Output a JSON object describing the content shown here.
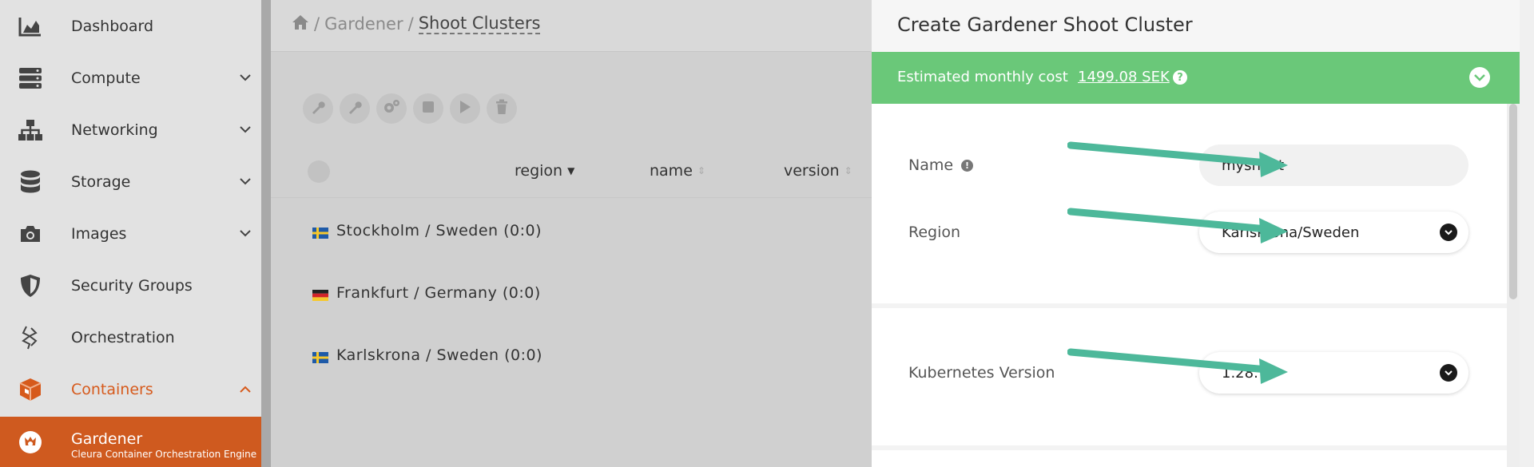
{
  "sidebar": {
    "items": [
      {
        "label": "Dashboard",
        "icon": "chart-area-icon"
      },
      {
        "label": "Compute",
        "icon": "server-icon"
      },
      {
        "label": "Networking",
        "icon": "sitemap-icon"
      },
      {
        "label": "Storage",
        "icon": "database-icon"
      },
      {
        "label": "Images",
        "icon": "camera-icon"
      },
      {
        "label": "Security Groups",
        "icon": "shield-icon"
      },
      {
        "label": "Orchestration",
        "icon": "orchestration-icon"
      },
      {
        "label": "Containers",
        "icon": "cube-icon"
      }
    ],
    "sub_item": {
      "label": "Gardener",
      "sublabel": "Cleura Container Orchestration Engine",
      "icon": "gardener-icon"
    },
    "accent_color": "#cf5a1f"
  },
  "breadcrumb": {
    "home_icon": "home-icon",
    "parent": "Gardener",
    "current": "Shoot Clusters"
  },
  "toolbar": {
    "icons": [
      "wrench-icon",
      "wrench-icon",
      "gears-icon",
      "stop-icon",
      "play-icon",
      "trash-icon"
    ]
  },
  "table": {
    "columns": [
      "region",
      "name",
      "version"
    ],
    "rows": [
      {
        "flag": "sweden",
        "label": "Stockholm / Sweden (0:0)"
      },
      {
        "flag": "germany",
        "label": "Frankfurt / Germany (0:0)"
      },
      {
        "flag": "sweden",
        "label": "Karlskrona / Sweden (0:0)"
      }
    ]
  },
  "panel": {
    "title": "Create Gardener Shoot Cluster",
    "cost_label": "Estimated monthly cost",
    "cost_value": "1499.08 SEK",
    "cost_color": "#6ac879",
    "fields": {
      "name": {
        "label": "Name",
        "value": "myshoot"
      },
      "region": {
        "label": "Region",
        "value": "Karlskrona/Sweden"
      },
      "k8s_version": {
        "label": "Kubernetes Version",
        "value": "1.28.7"
      }
    },
    "arrow_color": "#4db89a"
  }
}
